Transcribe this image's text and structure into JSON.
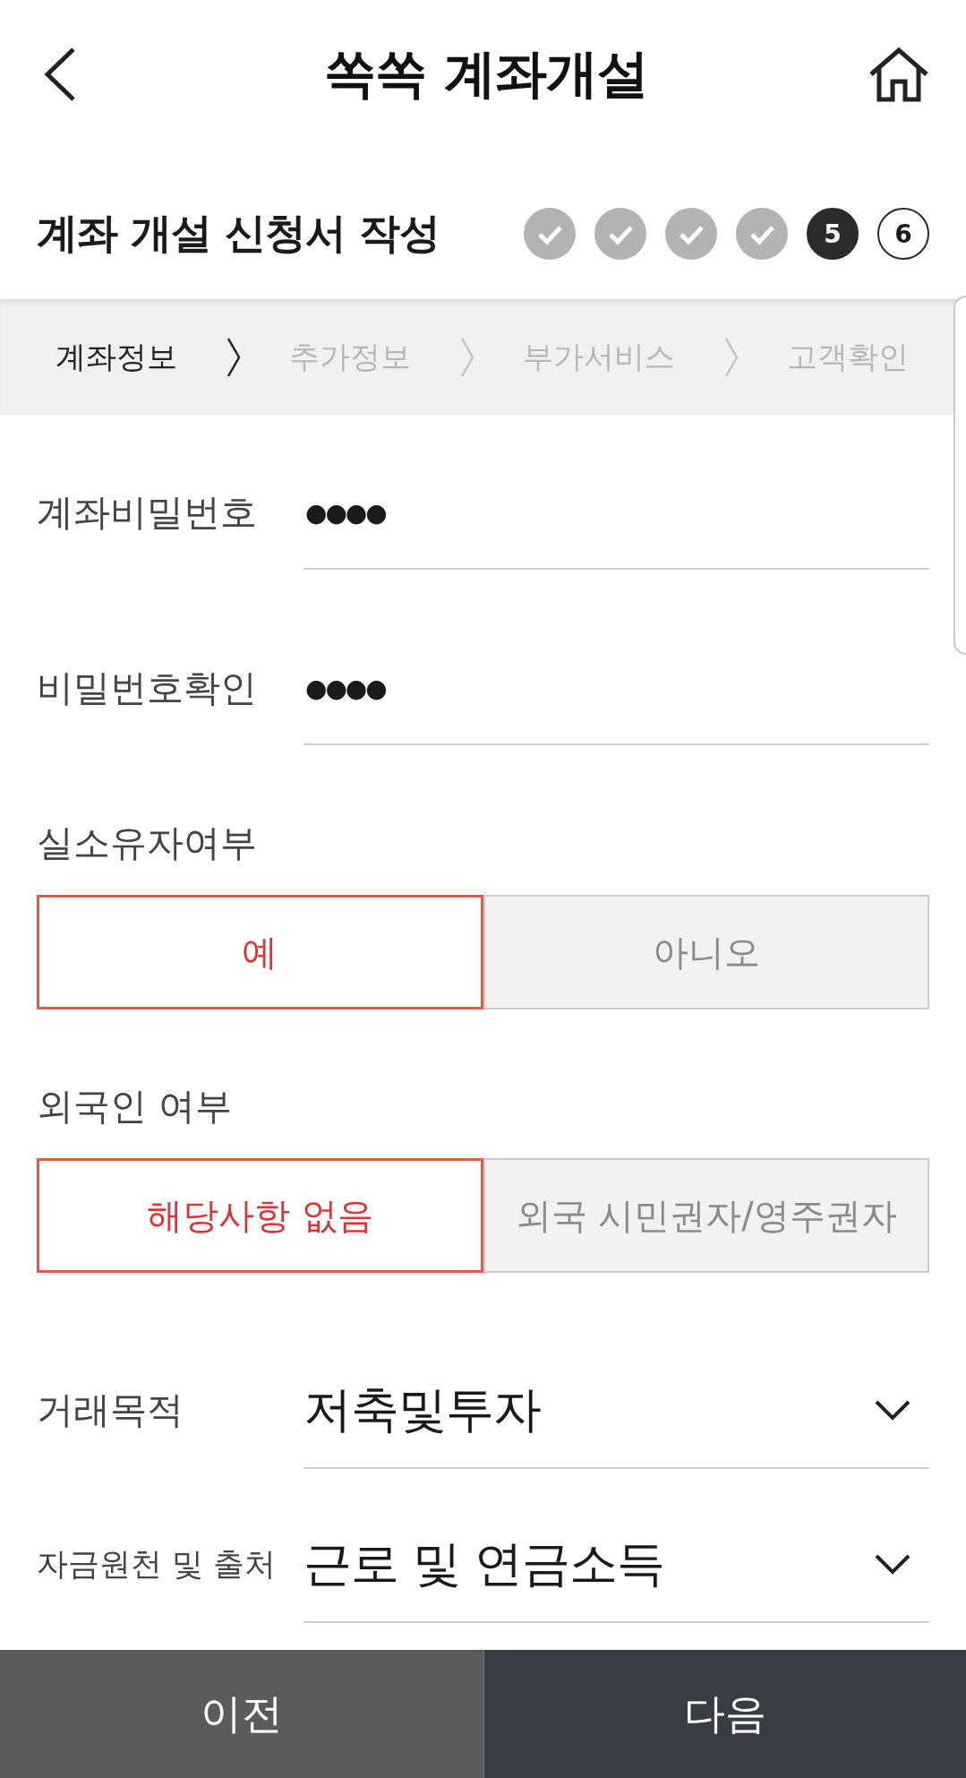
{
  "header": {
    "title": "쏙쏙 계좌개설"
  },
  "form_title": {
    "title": "계좌 개설 신청서 작성",
    "steps": [
      {
        "kind": "done"
      },
      {
        "kind": "done"
      },
      {
        "kind": "done"
      },
      {
        "kind": "done"
      },
      {
        "kind": "current",
        "label": "5"
      },
      {
        "kind": "upcoming",
        "label": "6"
      }
    ]
  },
  "tabs": [
    {
      "label": "계좌정보",
      "selected": true
    },
    {
      "label": "추가정보",
      "selected": false
    },
    {
      "label": "부가서비스",
      "selected": false
    },
    {
      "label": "고객확인",
      "selected": false
    }
  ],
  "fields": [
    {
      "kind": "password",
      "label": "계좌비밀번호",
      "value": "●●●●"
    },
    {
      "kind": "password",
      "label": "비밀번호확인",
      "value": "●●●●"
    },
    {
      "kind": "choice",
      "label": "실소유자여부",
      "options": [
        {
          "label": "예",
          "selected": true
        },
        {
          "label": "아니오",
          "selected": false
        }
      ]
    },
    {
      "kind": "choice",
      "label": "외국인 여부",
      "options": [
        {
          "label": "해당사항 없음",
          "selected": true
        },
        {
          "label": "외국 시민권자/영주권자",
          "selected": false
        }
      ]
    },
    {
      "kind": "select",
      "label": "거래목적",
      "value": "저축및투자"
    },
    {
      "kind": "select",
      "label": "자금원천 및 출처",
      "value": "근로 및 연금소득"
    }
  ],
  "buttons": [
    {
      "label": "이전",
      "kind": "secondary"
    },
    {
      "label": "다음",
      "kind": "primary"
    }
  ]
}
